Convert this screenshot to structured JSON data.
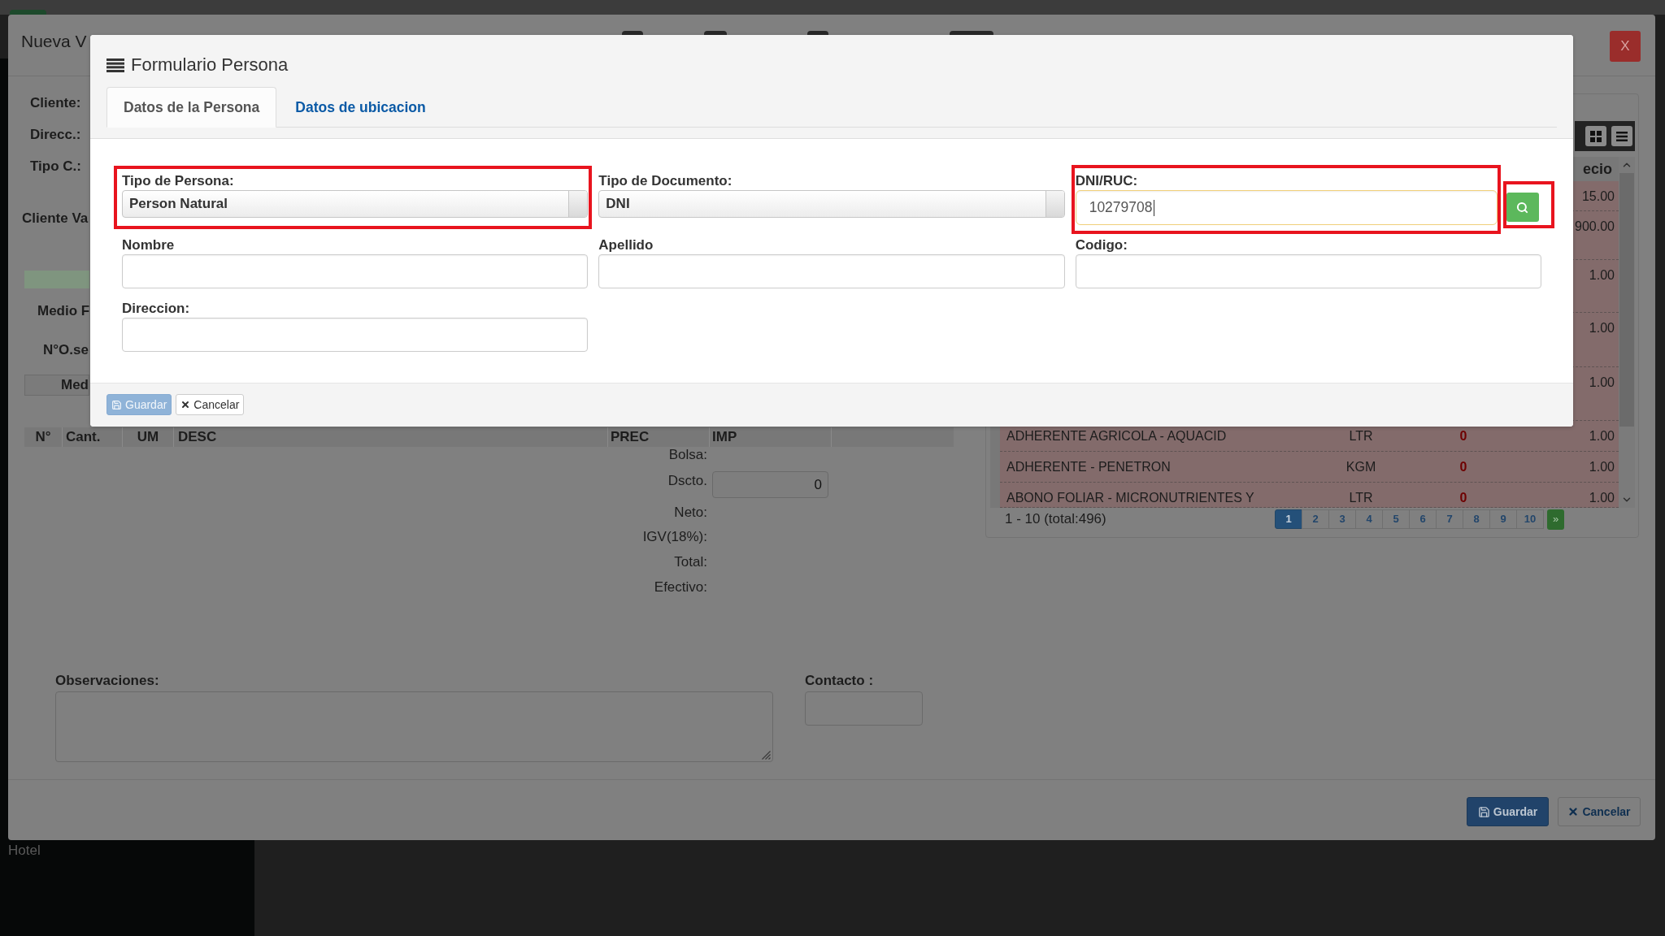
{
  "sidebar": {
    "items": [
      {
        "label": "Hotel"
      }
    ]
  },
  "sale_dialog": {
    "title": "Nueva V",
    "close_button": {
      "label": "X"
    },
    "client_fields": [
      {
        "label": "Cliente:"
      },
      {
        "label": "Direcc.:"
      },
      {
        "label": "Tipo C.:"
      }
    ],
    "client_section": {
      "title": "Cliente Va"
    },
    "payment_fields": [
      {
        "label": "Medio F"
      },
      {
        "label": "N°O.se"
      }
    ],
    "payment_tab": {
      "label": "Med"
    },
    "items_table": {
      "columns": [
        "N°",
        "Cant.",
        "UM",
        "DESC",
        "PREC",
        "IMP"
      ]
    },
    "totals": [
      {
        "label": "Bolsa:"
      },
      {
        "label": "Dscto.",
        "value": "0"
      },
      {
        "label": "Neto:"
      },
      {
        "label": "IGV(18%):"
      },
      {
        "label": "Total:"
      },
      {
        "label": "Efectivo:"
      }
    ],
    "observations": {
      "label": "Observaciones:"
    },
    "contact": {
      "label": "Contacto :"
    },
    "products": {
      "price_header": "ecio",
      "rows": [
        {
          "price": "15.00"
        },
        {
          "price": "900.00"
        },
        {
          "price": "1.00"
        },
        {
          "price": "1.00"
        },
        {
          "price": "1.00"
        },
        {
          "name": "ADHERENTE AGRICOLA - AQUACID",
          "unit": "LTR",
          "stock": "0",
          "price": "1.00"
        },
        {
          "name": "ADHERENTE - PENETRON",
          "unit": "KGM",
          "stock": "0",
          "price": "1.00"
        },
        {
          "name": "ABONO FOLIAR - MICRONUTRIENTES Y",
          "unit": "LTR",
          "stock": "0",
          "price": "1.00"
        }
      ],
      "pagination": {
        "summary": "1 - 10 (total:496)",
        "pages": [
          {
            "label": "1",
            "selected": true
          },
          {
            "label": "2",
            "selected": false
          },
          {
            "label": "3",
            "selected": false
          },
          {
            "label": "4",
            "selected": false
          },
          {
            "label": "5",
            "selected": false
          },
          {
            "label": "6",
            "selected": false
          },
          {
            "label": "7",
            "selected": false
          },
          {
            "label": "8",
            "selected": false
          },
          {
            "label": "9",
            "selected": false
          },
          {
            "label": "10",
            "selected": false
          }
        ],
        "next": "»"
      }
    },
    "buttons": [
      {
        "label": "Guardar",
        "kind": "primary"
      },
      {
        "label": "Cancelar",
        "kind": "cancel"
      }
    ]
  },
  "person_modal": {
    "title": "Formulario Persona",
    "tabs": [
      {
        "label": "Datos de la Persona",
        "selected": true
      },
      {
        "label": "Datos de ubicacion",
        "selected": false
      }
    ],
    "fields": [
      {
        "kind": "select",
        "label": "Tipo de Persona:",
        "value": "Person Natural",
        "highlighted": true,
        "focused": false
      },
      {
        "kind": "select",
        "label": "Tipo de Documento:",
        "value": "DNI",
        "highlighted": false,
        "focused": false
      },
      {
        "kind": "search",
        "label": "DNI/RUC:",
        "value": "10279708",
        "highlighted": true,
        "focused": true,
        "search_button": {
          "highlighted": true
        }
      },
      {
        "kind": "text",
        "label": "Nombre",
        "highlighted": false,
        "focused": false
      },
      {
        "kind": "text",
        "label": "Apellido",
        "highlighted": false,
        "focused": false
      },
      {
        "kind": "text",
        "label": "Codigo:",
        "highlighted": false,
        "focused": false
      },
      {
        "kind": "text",
        "label": "Direccion:",
        "highlighted": false,
        "focused": false
      }
    ],
    "buttons": [
      {
        "label": "Guardar",
        "kind": "primary",
        "disabled": true
      },
      {
        "label": "Cancelar",
        "kind": "cancel",
        "disabled": false
      }
    ]
  }
}
